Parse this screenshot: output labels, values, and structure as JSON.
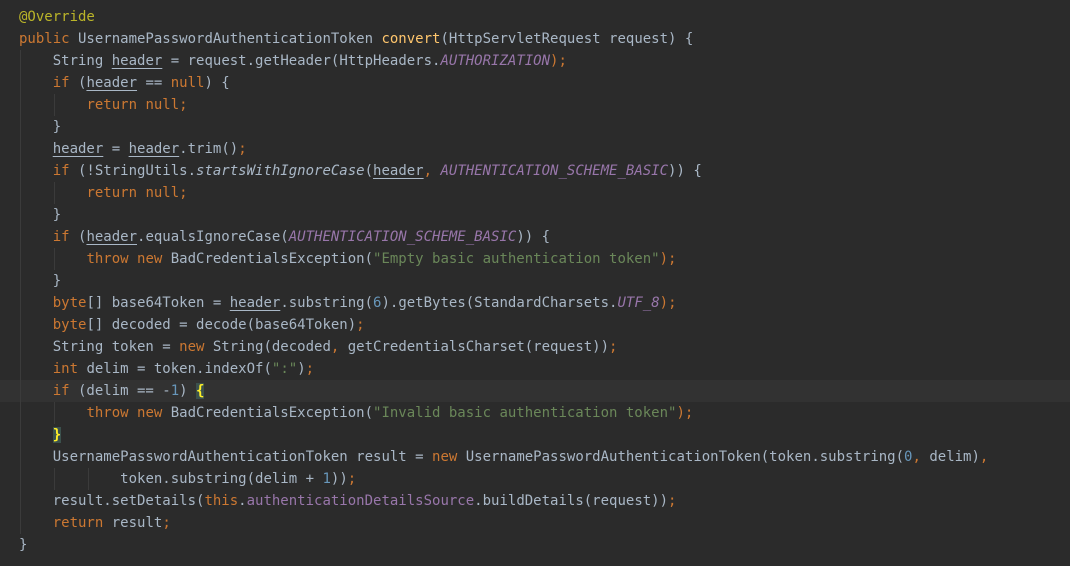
{
  "editor": {
    "language": "java",
    "current_line_index": 17,
    "colors": {
      "background": "#2b2b2b",
      "current_line": "#323232",
      "default_text": "#a9b7c6",
      "keyword": "#cc7832",
      "annotation": "#bbb529",
      "method_declaration": "#ffc66d",
      "string": "#6a8759",
      "number": "#6897bb",
      "constant_field": "#9876aa",
      "matched_brace": "#ffef28"
    },
    "lines": [
      {
        "indent": 0,
        "tokens": [
          [
            "@Override",
            "ann"
          ]
        ]
      },
      {
        "indent": 0,
        "tokens": [
          [
            "public",
            "kw"
          ],
          [
            " UsernamePasswordAuthenticationToken ",
            "plain"
          ],
          [
            "convert",
            "fn"
          ],
          [
            "(HttpServletRequest request) {",
            "plain"
          ]
        ]
      },
      {
        "indent": 1,
        "tokens": [
          [
            "String ",
            "plain"
          ],
          [
            "header",
            "var"
          ],
          [
            " = request.getHeader(HttpHeaders.",
            "plain"
          ],
          [
            "AUTHORIZATION",
            "const"
          ],
          [
            ");",
            "kw"
          ]
        ]
      },
      {
        "indent": 1,
        "tokens": [
          [
            "if",
            "kw"
          ],
          [
            " (",
            "plain"
          ],
          [
            "header",
            "var"
          ],
          [
            " == ",
            "plain"
          ],
          [
            "null",
            "kw"
          ],
          [
            ") {",
            "plain"
          ]
        ]
      },
      {
        "indent": 2,
        "tokens": [
          [
            "return null;",
            "kw"
          ]
        ]
      },
      {
        "indent": 1,
        "tokens": [
          [
            "}",
            "plain"
          ]
        ]
      },
      {
        "indent": 1,
        "tokens": [
          [
            "header",
            "var"
          ],
          [
            " = ",
            "plain"
          ],
          [
            "header",
            "var"
          ],
          [
            ".trim()",
            "plain"
          ],
          [
            ";",
            "kw"
          ]
        ]
      },
      {
        "indent": 1,
        "tokens": [
          [
            "if",
            "kw"
          ],
          [
            " (!StringUtils.",
            "plain"
          ],
          [
            "startsWithIgnoreCase",
            "static"
          ],
          [
            "(",
            "plain"
          ],
          [
            "header",
            "var"
          ],
          [
            ", ",
            "kw"
          ],
          [
            "AUTHENTICATION_SCHEME_BASIC",
            "const"
          ],
          [
            ")) {",
            "plain"
          ]
        ]
      },
      {
        "indent": 2,
        "tokens": [
          [
            "return null;",
            "kw"
          ]
        ]
      },
      {
        "indent": 1,
        "tokens": [
          [
            "}",
            "plain"
          ]
        ]
      },
      {
        "indent": 1,
        "tokens": [
          [
            "if",
            "kw"
          ],
          [
            " (",
            "plain"
          ],
          [
            "header",
            "var"
          ],
          [
            ".equalsIgnoreCase(",
            "plain"
          ],
          [
            "AUTHENTICATION_SCHEME_BASIC",
            "const"
          ],
          [
            ")) {",
            "plain"
          ]
        ]
      },
      {
        "indent": 2,
        "tokens": [
          [
            "throw new",
            "kw"
          ],
          [
            " BadCredentialsException(",
            "plain"
          ],
          [
            "\"Empty basic authentication token\"",
            "str"
          ],
          [
            ");",
            "kw"
          ]
        ]
      },
      {
        "indent": 1,
        "tokens": [
          [
            "}",
            "plain"
          ]
        ]
      },
      {
        "indent": 1,
        "tokens": [
          [
            "byte",
            "kw"
          ],
          [
            "[] base64Token = ",
            "plain"
          ],
          [
            "header",
            "var"
          ],
          [
            ".substring(",
            "plain"
          ],
          [
            "6",
            "num"
          ],
          [
            ").getBytes(StandardCharsets.",
            "plain"
          ],
          [
            "UTF_8",
            "const"
          ],
          [
            ");",
            "kw"
          ]
        ]
      },
      {
        "indent": 1,
        "tokens": [
          [
            "byte",
            "kw"
          ],
          [
            "[] decoded = decode(base64Token)",
            "plain"
          ],
          [
            ";",
            "kw"
          ]
        ]
      },
      {
        "indent": 1,
        "tokens": [
          [
            "String token = ",
            "plain"
          ],
          [
            "new",
            "kw"
          ],
          [
            " String(decoded",
            "plain"
          ],
          [
            ", ",
            "kw"
          ],
          [
            "getCredentialsCharset(request))",
            "plain"
          ],
          [
            ";",
            "kw"
          ]
        ]
      },
      {
        "indent": 1,
        "tokens": [
          [
            "int",
            "kw"
          ],
          [
            " delim = token.indexOf(",
            "plain"
          ],
          [
            "\":\"",
            "str"
          ],
          [
            ")",
            "plain"
          ],
          [
            ";",
            "kw"
          ]
        ]
      },
      {
        "indent": 1,
        "tokens": [
          [
            "if",
            "kw"
          ],
          [
            " (delim == -",
            "plain"
          ],
          [
            "1",
            "num"
          ],
          [
            ") ",
            "plain"
          ],
          [
            "{",
            "brace"
          ]
        ]
      },
      {
        "indent": 2,
        "tokens": [
          [
            "throw new",
            "kw"
          ],
          [
            " BadCredentialsException(",
            "plain"
          ],
          [
            "\"Invalid basic authentication token\"",
            "str"
          ],
          [
            ");",
            "kw"
          ]
        ]
      },
      {
        "indent": 1,
        "tokens": [
          [
            "}",
            "brace"
          ]
        ]
      },
      {
        "indent": 1,
        "tokens": [
          [
            "UsernamePasswordAuthenticationToken result = ",
            "plain"
          ],
          [
            "new",
            "kw"
          ],
          [
            " UsernamePasswordAuthenticationToken(token.substring(",
            "plain"
          ],
          [
            "0",
            "num"
          ],
          [
            ", ",
            "kw"
          ],
          [
            "delim)",
            "plain"
          ],
          [
            ",",
            "kw"
          ]
        ]
      },
      {
        "indent": 3,
        "tokens": [
          [
            "token.substring(delim + ",
            "plain"
          ],
          [
            "1",
            "num"
          ],
          [
            "))",
            "plain"
          ],
          [
            ";",
            "kw"
          ]
        ]
      },
      {
        "indent": 1,
        "tokens": [
          [
            "result.setDetails(",
            "plain"
          ],
          [
            "this",
            "kw"
          ],
          [
            ".",
            "plain"
          ],
          [
            "authenticationDetailsSource",
            "field"
          ],
          [
            ".buildDetails(request))",
            "plain"
          ],
          [
            ";",
            "kw"
          ]
        ]
      },
      {
        "indent": 1,
        "tokens": [
          [
            "return",
            "kw"
          ],
          [
            " result",
            "plain"
          ],
          [
            ";",
            "kw"
          ]
        ]
      },
      {
        "indent": 0,
        "tokens": [
          [
            "}",
            "plain"
          ]
        ]
      }
    ]
  }
}
